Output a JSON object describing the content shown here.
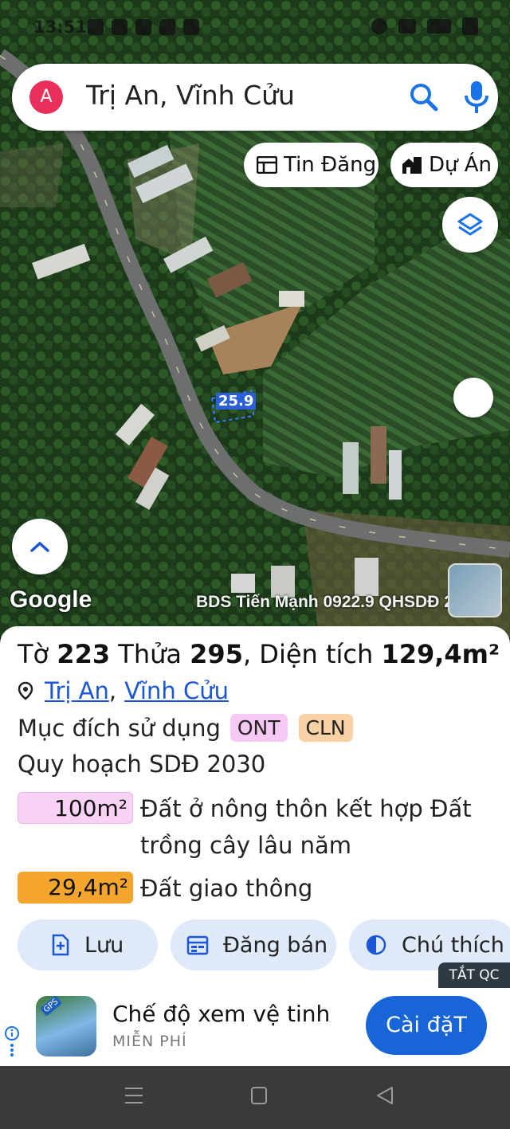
{
  "status_bar": {
    "time": "13:51"
  },
  "search": {
    "avatar_letter": "A",
    "query": "Trị An, Vĩnh Cửu"
  },
  "chips": {
    "tin_dang": "Tin Đăng",
    "du_an": "Dự Án"
  },
  "map": {
    "plot_label": "25.9",
    "google_logo": "Google",
    "watermark": "BDS Tiến Mạnh 0922.9 QHSDĐ 2030"
  },
  "parcel": {
    "to_label": "Tờ",
    "to_value": "223",
    "thua_label": "Thửa",
    "thua_value": "295",
    "dientich_label": ", Diện tích",
    "dientich_value": "129,4m²",
    "location_1": "Trị An",
    "location_sep": ",",
    "location_2": "Vĩnh Cửu",
    "muc_dich_label": "Mục đích sử dụng",
    "tag_ont": "ONT",
    "tag_cln": "CLN",
    "quy_hoach": "Quy hoạch SDĐ 2030",
    "area_1_value": "100m²",
    "area_1_desc": "Đất ở nông thôn kết hợp Đất trồng cây lâu năm",
    "area_2_value": "29,4m²",
    "area_2_desc": "Đất giao thông",
    "colors": {
      "ont": "#f8c8f4",
      "cln": "#f8d2a4",
      "giao_thong": "#f4a52c"
    }
  },
  "actions": {
    "luu": "Lưu",
    "dang_ban": "Đăng bán",
    "chu_thich": "Chú thích"
  },
  "ad": {
    "tat_qc": "TẮT QC",
    "app_title": "Chế độ xem vệ tinh",
    "subtitle": "MIỄN PHÍ",
    "install": "Cài đặT",
    "icon_badge": "GPS"
  }
}
